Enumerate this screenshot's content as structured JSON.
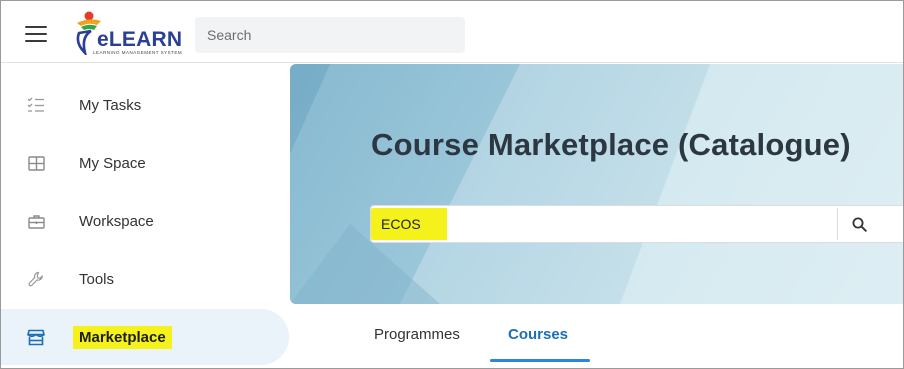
{
  "topbar": {
    "menu_icon": "hamburger-menu-icon",
    "logo_text": "eLEARN",
    "logo_tagline": "LEARNING MANAGEMENT SYSTEM",
    "search_placeholder": "Search"
  },
  "sidebar": {
    "items": [
      {
        "label": "My Tasks",
        "icon": "task-list-icon",
        "active": false
      },
      {
        "label": "My Space",
        "icon": "grid-icon",
        "active": false
      },
      {
        "label": "Workspace",
        "icon": "briefcase-icon",
        "active": false
      },
      {
        "label": "Tools",
        "icon": "wrench-icon",
        "active": false
      },
      {
        "label": "Marketplace",
        "icon": "store-icon",
        "active": true
      }
    ]
  },
  "hero": {
    "title": "Course Marketplace (Catalogue)",
    "search_value": "ECOS",
    "search_button_icon": "search-icon"
  },
  "tabs": [
    {
      "label": "Programmes",
      "active": false
    },
    {
      "label": "Courses",
      "active": true
    }
  ],
  "colors": {
    "accent": "#1c6fb5",
    "highlight": "#f4f21a",
    "active_nav_bg": "#eaf2fa",
    "logo_blue": "#2a3f95"
  }
}
